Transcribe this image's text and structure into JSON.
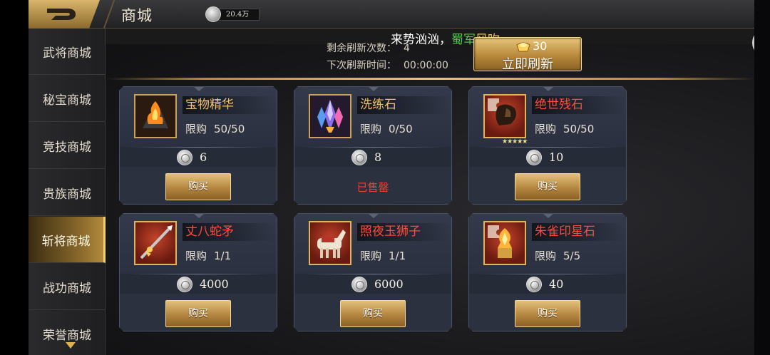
{
  "header": {
    "title": "商城",
    "currency_amount": "20.4万"
  },
  "banner": {
    "part1": "来势汹汹，",
    "part2": "蜀军",
    "part3": "风吹"
  },
  "sidebar": {
    "items": [
      {
        "label": "武将商城"
      },
      {
        "label": "秘宝商城"
      },
      {
        "label": "竞技商城"
      },
      {
        "label": "贵族商城"
      },
      {
        "label": "斩将商城"
      },
      {
        "label": "战功商城"
      },
      {
        "label": "荣誉商城"
      }
    ],
    "active_index": 4
  },
  "refresh": {
    "remaining_label": "剩余刷新次数：",
    "remaining_value": "4",
    "next_label": "下次刷新时间：",
    "next_value": "00:00:00",
    "cost": "30",
    "button_label": "立即刷新"
  },
  "shop": {
    "items": [
      {
        "name": "宝物精华",
        "name_color": "gold",
        "limit_label": "限购",
        "limit": "50/50",
        "price": "6",
        "buy_label": "购买",
        "sold_out": false,
        "icon": "fire-crystal-icon"
      },
      {
        "name": "洗练石",
        "name_color": "gold",
        "limit_label": "限购",
        "limit": "0/50",
        "price": "8",
        "sold_label": "已售罄",
        "sold_out": true,
        "icon": "crystal-cluster-icon"
      },
      {
        "name": "绝世残石",
        "name_color": "red",
        "limit_label": "限购",
        "limit": "50/50",
        "price": "10",
        "buy_label": "购买",
        "sold_out": false,
        "icon": "puzzle-stone-icon",
        "stars": "★★★★★"
      },
      {
        "name": "丈八蛇矛",
        "name_color": "red",
        "limit_label": "限购",
        "limit": "1/1",
        "price": "4000",
        "buy_label": "购买",
        "sold_out": false,
        "icon": "spear-icon"
      },
      {
        "name": "照夜玉狮子",
        "name_color": "red",
        "limit_label": "限购",
        "limit": "1/1",
        "price": "6000",
        "buy_label": "购买",
        "sold_out": false,
        "icon": "horse-icon"
      },
      {
        "name": "朱雀印星石",
        "name_color": "red",
        "limit_label": "限购",
        "limit": "5/5",
        "price": "40",
        "buy_label": "购买",
        "sold_out": false,
        "icon": "phoenix-seal-icon"
      }
    ]
  },
  "colors": {
    "gold_text": "#f2c16a",
    "red_text": "#ff4b3a",
    "green_text": "#49c84a",
    "accent_gold": "#e8c47a"
  }
}
